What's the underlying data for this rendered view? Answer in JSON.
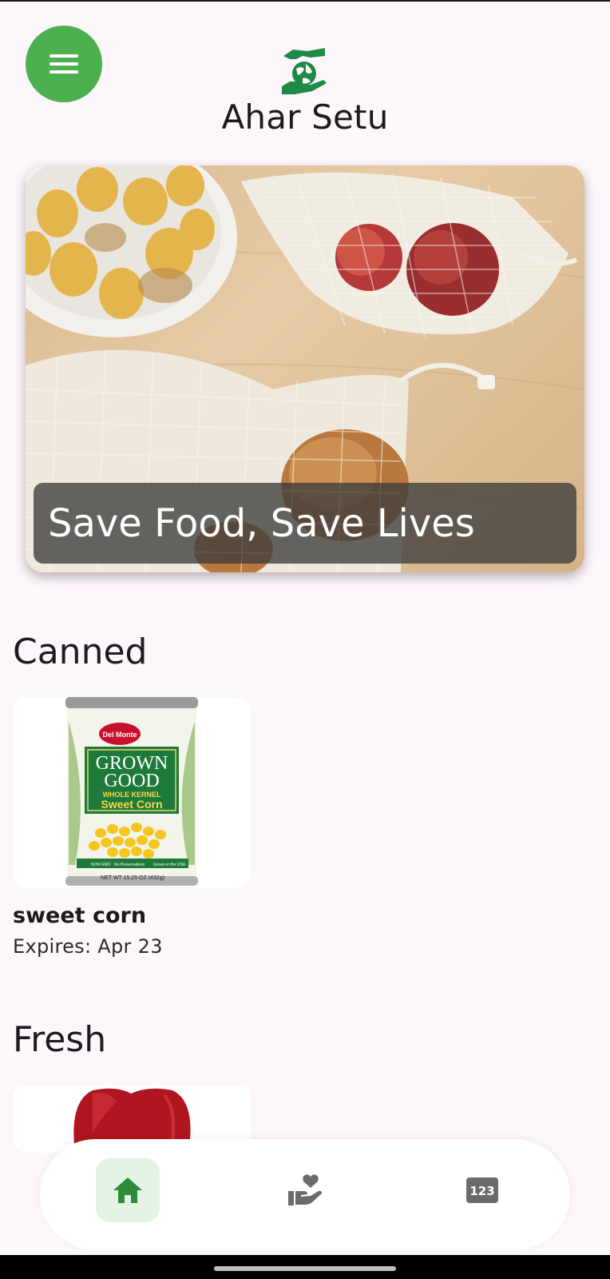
{
  "header": {
    "app_title": "Ahar Setu",
    "menu_icon": "hamburger-icon",
    "logo_icon": "hand-globe-logo-icon"
  },
  "hero": {
    "caption": "Save Food, Save Lives"
  },
  "sections": [
    {
      "title": "Canned",
      "items": [
        {
          "name": "sweet corn",
          "expires": "Expires: Apr 23",
          "label": {
            "brand": "Del Monte",
            "line1": "GROWN",
            "line2": "GOOD",
            "line3": "WHOLE KERNEL",
            "line4": "Sweet Corn",
            "tag1": "NON GMO",
            "tag2": "No Preservatives",
            "tag3": "Grown in the USA",
            "net": "NET WT 15.25 OZ (432g)"
          }
        }
      ]
    },
    {
      "title": "Fresh",
      "items": [
        {
          "image_icon": "red-apple-icon"
        }
      ]
    }
  ],
  "bottom_nav": {
    "items": [
      {
        "icon": "home-icon",
        "active": true
      },
      {
        "icon": "donate-hand-heart-icon",
        "active": false
      },
      {
        "icon": "numbers-123-icon",
        "label": "123",
        "active": false
      }
    ]
  },
  "colors": {
    "accent": "#4caf50",
    "background": "#fdf6fb",
    "active_nav_bg": "#e3f3e4",
    "icon_grey": "#6b6b6b"
  }
}
